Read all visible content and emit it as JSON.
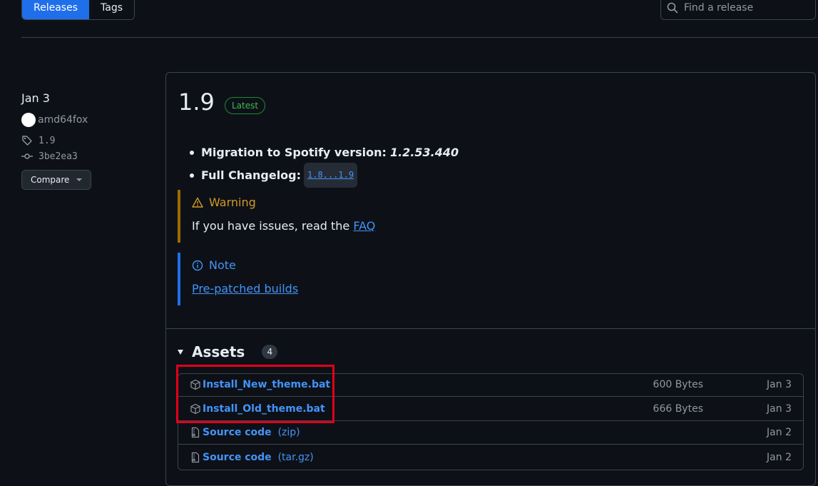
{
  "tabs": {
    "releases": "Releases",
    "tags": "Tags"
  },
  "search": {
    "placeholder": "Find a release"
  },
  "meta": {
    "date": "Jan 3",
    "author": "amd64fox",
    "tag": "1.9",
    "commit": "3be2ea3",
    "compare_label": "Compare"
  },
  "release": {
    "version": "1.9",
    "badge": "Latest",
    "bullets": [
      {
        "label": "Migration to Spotify version:",
        "value": "1.2.53.440"
      },
      {
        "label": "Full Changelog:",
        "value": "1.8...1.9"
      }
    ],
    "warning": {
      "title": "Warning",
      "text": "If you have issues, read the",
      "link": "FAQ"
    },
    "note": {
      "title": "Note",
      "link": "Pre-patched builds"
    }
  },
  "assets": {
    "title": "Assets",
    "count": "4",
    "items": [
      {
        "name": "Install_New_theme.bat",
        "suffix": "",
        "size": "600 Bytes",
        "date": "Jan 3"
      },
      {
        "name": "Install_Old_theme.bat",
        "suffix": "",
        "size": "666 Bytes",
        "date": "Jan 3"
      },
      {
        "name": "Source code",
        "suffix": "(zip)",
        "size": "",
        "date": "Jan 2"
      },
      {
        "name": "Source code",
        "suffix": "(tar.gz)",
        "size": "",
        "date": "Jan 2"
      }
    ]
  },
  "colors": {
    "accent": "#1f6feb",
    "link": "#4493f8",
    "warning": "#d29922",
    "highlight": "#e0001b",
    "latest": "#3fb950"
  }
}
